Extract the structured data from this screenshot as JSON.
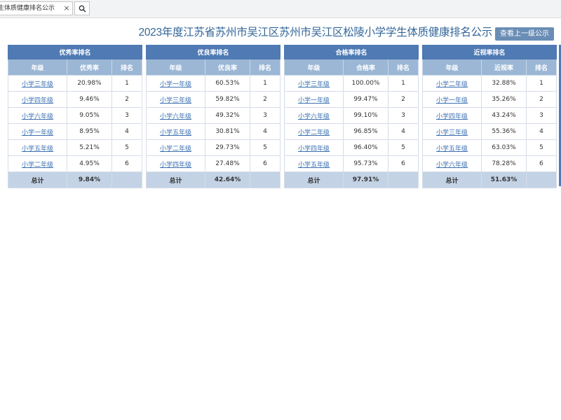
{
  "search": {
    "value": "生体质健康排名公示",
    "clear_label": "×"
  },
  "title": "2023年度江苏省苏州市吴江区苏州市吴江区松陵小学学生体质健康排名公示",
  "prev_button": "查看上一级公示",
  "tables": [
    {
      "caption": "优秀率排名",
      "headers": [
        "年级",
        "优秀率",
        "排名"
      ],
      "rows": [
        {
          "grade": "小学三年级",
          "rate": "20.98%",
          "rank": "1"
        },
        {
          "grade": "小学四年级",
          "rate": "9.46%",
          "rank": "2"
        },
        {
          "grade": "小学六年级",
          "rate": "9.05%",
          "rank": "3"
        },
        {
          "grade": "小学一年级",
          "rate": "8.95%",
          "rank": "4"
        },
        {
          "grade": "小学五年级",
          "rate": "5.21%",
          "rank": "5"
        },
        {
          "grade": "小学二年级",
          "rate": "4.95%",
          "rank": "6"
        }
      ],
      "total_label": "总计",
      "total_value": "9.84%"
    },
    {
      "caption": "优良率排名",
      "headers": [
        "年级",
        "优良率",
        "排名"
      ],
      "rows": [
        {
          "grade": "小学一年级",
          "rate": "60.53%",
          "rank": "1"
        },
        {
          "grade": "小学三年级",
          "rate": "59.82%",
          "rank": "2"
        },
        {
          "grade": "小学六年级",
          "rate": "49.32%",
          "rank": "3"
        },
        {
          "grade": "小学五年级",
          "rate": "30.81%",
          "rank": "4"
        },
        {
          "grade": "小学二年级",
          "rate": "29.73%",
          "rank": "5"
        },
        {
          "grade": "小学四年级",
          "rate": "27.48%",
          "rank": "6"
        }
      ],
      "total_label": "总计",
      "total_value": "42.64%"
    },
    {
      "caption": "合格率排名",
      "headers": [
        "年级",
        "合格率",
        "排名"
      ],
      "rows": [
        {
          "grade": "小学三年级",
          "rate": "100.00%",
          "rank": "1"
        },
        {
          "grade": "小学一年级",
          "rate": "99.47%",
          "rank": "2"
        },
        {
          "grade": "小学六年级",
          "rate": "99.10%",
          "rank": "3"
        },
        {
          "grade": "小学二年级",
          "rate": "96.85%",
          "rank": "4"
        },
        {
          "grade": "小学四年级",
          "rate": "96.40%",
          "rank": "5"
        },
        {
          "grade": "小学五年级",
          "rate": "95.73%",
          "rank": "6"
        }
      ],
      "total_label": "总计",
      "total_value": "97.91%"
    },
    {
      "caption": "近视率排名",
      "headers": [
        "年级",
        "近视率",
        "排名"
      ],
      "rows": [
        {
          "grade": "小学二年级",
          "rate": "32.88%",
          "rank": "1"
        },
        {
          "grade": "小学一年级",
          "rate": "35.26%",
          "rank": "2"
        },
        {
          "grade": "小学四年级",
          "rate": "43.24%",
          "rank": "3"
        },
        {
          "grade": "小学三年级",
          "rate": "55.36%",
          "rank": "4"
        },
        {
          "grade": "小学五年级",
          "rate": "63.03%",
          "rank": "5"
        },
        {
          "grade": "小学六年级",
          "rate": "78.28%",
          "rank": "6"
        }
      ],
      "total_label": "总计",
      "total_value": "51.63%"
    }
  ]
}
